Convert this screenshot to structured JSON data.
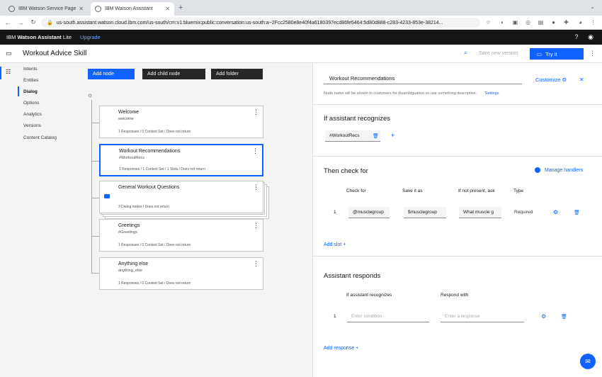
{
  "browser": {
    "tabs": [
      {
        "title": "IBM Watson Service Page"
      },
      {
        "title": "IBM Watson Assistant"
      }
    ],
    "new_tab": "+",
    "url": "us-south.assistant.watson.cloud.ibm.com/us-south/crn:v1:bluemix:public:conversation:us-south:a~2Fcc2580e8e40f4a6180397ecd86fe5464:5d80d888-c283-4233-853e-38214..."
  },
  "ibm_header": {
    "brand_prefix": "IBM",
    "brand_name": "Watson Assistant",
    "brand_suffix": "Lite",
    "upgrade": "Upgrade"
  },
  "skill": {
    "title": "Workout Advice Skill",
    "save_version": "Save new version",
    "try_it": "Try it"
  },
  "nav": {
    "items": [
      "Intents",
      "Entities",
      "Dialog",
      "Options",
      "Analytics",
      "Versions",
      "Content Catalog"
    ],
    "active": "Dialog"
  },
  "toolbar": {
    "add_node": "Add node",
    "add_child_node": "Add child node",
    "add_folder": "Add folder"
  },
  "nodes": [
    {
      "title": "Welcome",
      "condition": "welcome",
      "meta": "1 Responses / 0 Context Set / Does not return"
    },
    {
      "title": "Workout Recommendations",
      "condition": "#WorkoutRecs",
      "meta": "1 Responses / 1 Context Set / 1 Slots / Does not return"
    },
    {
      "title": "General Workout Questions",
      "condition": "",
      "meta": "3 Dialog nodes / Does not return"
    },
    {
      "title": "Greetings",
      "condition": "#Greetings",
      "meta": "1 Responses / 0 Context Set / Does not return"
    },
    {
      "title": "Anything else",
      "condition": "anything_else",
      "meta": "1 Responses / 0 Context Set / Does not return"
    }
  ],
  "panel": {
    "node_name": "Workout Recommendations",
    "customize": "Customize",
    "helper_text": "Node name will be shown to customers for disambiguation so use something descriptive.",
    "settings": "Settings",
    "recognizes_heading": "If assistant recognizes",
    "condition": "#WorkoutRecs",
    "check_heading": "Then check for",
    "manage_handlers": "Manage handlers",
    "slot_cols": [
      "Check for",
      "Save it as",
      "If not present, ask",
      "Type"
    ],
    "slot_row": {
      "num": "1",
      "check_for": "@musclegroup",
      "save_as": "$musclegroup",
      "ask": "What muscle g",
      "type": "Required"
    },
    "add_slot": "Add slot",
    "responds_heading": "Assistant responds",
    "resp_cols": [
      "If assistant recognizes",
      "Respond with"
    ],
    "resp_row": {
      "num": "1",
      "condition_placeholder": "Enter condition",
      "response_placeholder": "Enter a response"
    },
    "add_response": "Add response"
  },
  "colors": {
    "accent": "#0f62fe",
    "header": "#161616",
    "canvas": "#f4f4f4"
  }
}
